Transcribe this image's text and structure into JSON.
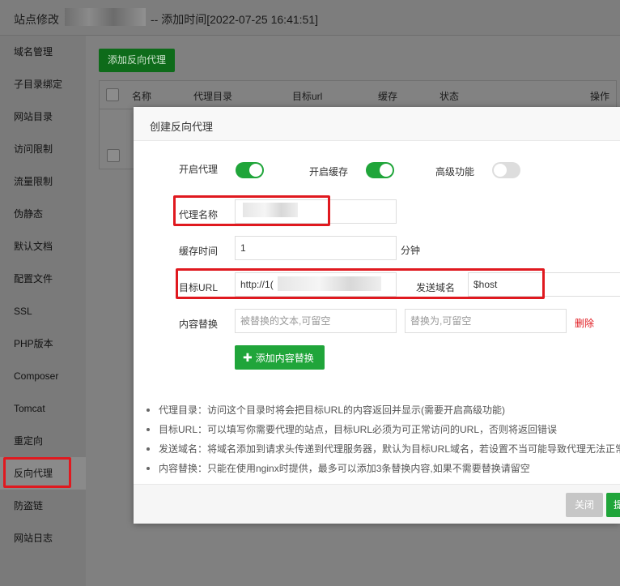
{
  "header": {
    "title_prefix": "站点修改",
    "title_suffix": "-- 添加时间[2022-07-25 16:41:51]"
  },
  "sidebar": {
    "items": [
      {
        "label": "域名管理"
      },
      {
        "label": "子目录绑定"
      },
      {
        "label": "网站目录"
      },
      {
        "label": "访问限制"
      },
      {
        "label": "流量限制"
      },
      {
        "label": "伪静态"
      },
      {
        "label": "默认文档"
      },
      {
        "label": "配置文件"
      },
      {
        "label": "SSL"
      },
      {
        "label": "PHP版本"
      },
      {
        "label": "Composer"
      },
      {
        "label": "Tomcat"
      },
      {
        "label": "重定向"
      },
      {
        "label": "反向代理"
      },
      {
        "label": "防盗链"
      },
      {
        "label": "网站日志"
      }
    ],
    "active": "反向代理"
  },
  "main": {
    "add_proxy_button": "添加反向代理",
    "table": {
      "columns": [
        "名称",
        "代理目录",
        "目标url",
        "缓存",
        "状态",
        "操作"
      ]
    }
  },
  "modal": {
    "title": "创建反向代理",
    "toggles": {
      "enable_proxy": {
        "label": "开启代理",
        "on": true
      },
      "enable_cache": {
        "label": "开启缓存",
        "on": true
      },
      "advanced": {
        "label": "高级功能",
        "on": false
      }
    },
    "fields": {
      "proxy_name": {
        "label": "代理名称",
        "value": ""
      },
      "cache_time": {
        "label": "缓存时间",
        "value": "1",
        "unit": "分钟"
      },
      "target_url": {
        "label": "目标URL",
        "value": "http://1("
      },
      "send_domain": {
        "label": "发送域名",
        "value": "$host"
      },
      "content_replace": {
        "label": "内容替换",
        "from_placeholder": "被替换的文本,可留空",
        "to_placeholder": "替换为,可留空",
        "delete_label": "删除"
      }
    },
    "add_content_button": "添加内容替换",
    "tips": [
      "代理目录：访问这个目录时将会把目标URL的内容返回并显示(需要开启高级功能)",
      "目标URL：可以填写你需要代理的站点，目标URL必须为可正常访问的URL，否则将返回错误",
      "发送域名：将域名添加到请求头传递到代理服务器，默认为目标URL域名，若设置不当可能导致代理无法正常",
      "内容替换：只能在使用nginx时提供，最多可以添加3条替换内容,如果不需要替换请留空"
    ],
    "footer": {
      "close_label": "关闭",
      "submit_label": "提"
    }
  },
  "colors": {
    "accent_green": "#20a53a",
    "highlight_red": "#e0191f"
  }
}
